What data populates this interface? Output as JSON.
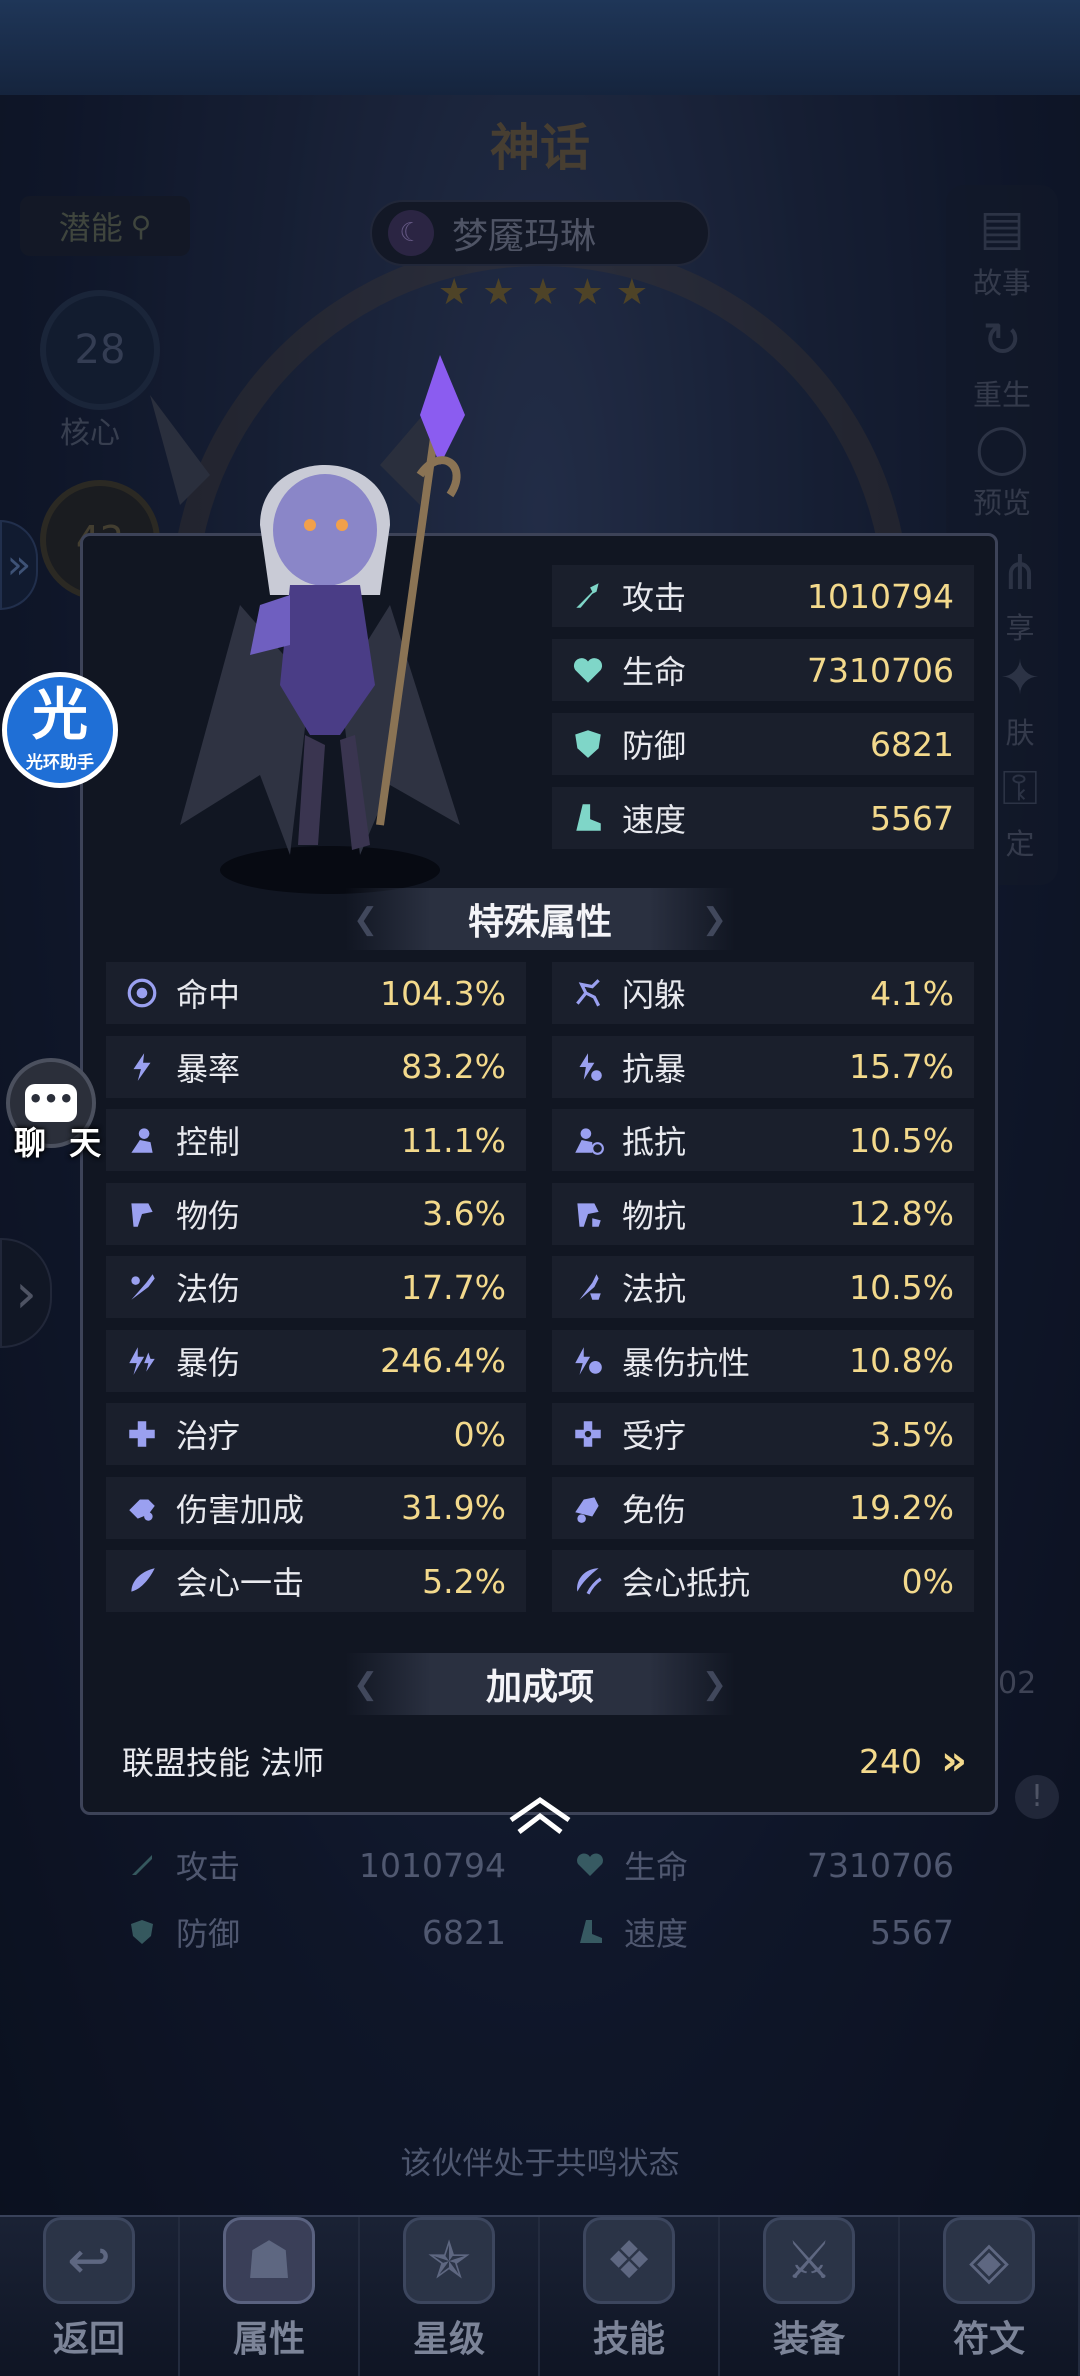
{
  "hero": {
    "tier_title": "神话",
    "name": "梦魇玛琳",
    "stars": 5
  },
  "left_panel": {
    "potential_label": "潜能",
    "core_level": "28",
    "core_label": "核心",
    "second_level": "42"
  },
  "right_rail": [
    {
      "label": "故事",
      "icon": "book-icon"
    },
    {
      "label": "重生",
      "icon": "rebirth-icon"
    },
    {
      "label": "预览",
      "icon": "preview-icon"
    },
    {
      "label": "享",
      "icon": "share-icon"
    },
    {
      "label": "肤",
      "icon": "skin-icon"
    },
    {
      "label": "定",
      "icon": "lock-icon"
    }
  ],
  "overlay": {
    "guanghuan_glyph": "光",
    "guanghuan_label": "光环助手",
    "chat_label": "聊 天"
  },
  "base_stats": [
    {
      "label": "攻击",
      "value": "1010794",
      "icon": "attack-icon"
    },
    {
      "label": "生命",
      "value": "7310706",
      "icon": "heart-icon"
    },
    {
      "label": "防御",
      "value": "6821",
      "icon": "shield-icon"
    },
    {
      "label": "速度",
      "value": "5567",
      "icon": "boot-icon"
    }
  ],
  "special_title": "特殊属性",
  "special_stats": [
    {
      "label": "命中",
      "value": "104.3%",
      "icon": "target-icon"
    },
    {
      "label": "闪躲",
      "value": "4.1%",
      "icon": "dodge-icon"
    },
    {
      "label": "暴率",
      "value": "83.2%",
      "icon": "crit-rate-icon"
    },
    {
      "label": "抗暴",
      "value": "15.7%",
      "icon": "crit-resist-icon"
    },
    {
      "label": "控制",
      "value": "11.1%",
      "icon": "control-icon"
    },
    {
      "label": "抵抗",
      "value": "10.5%",
      "icon": "resist-icon"
    },
    {
      "label": "物伤",
      "value": "3.6%",
      "icon": "phys-dmg-icon"
    },
    {
      "label": "物抗",
      "value": "12.8%",
      "icon": "phys-resist-icon"
    },
    {
      "label": "法伤",
      "value": "17.7%",
      "icon": "magic-dmg-icon"
    },
    {
      "label": "法抗",
      "value": "10.5%",
      "icon": "magic-resist-icon"
    },
    {
      "label": "暴伤",
      "value": "246.4%",
      "icon": "crit-dmg-icon"
    },
    {
      "label": "暴伤抗性",
      "value": "10.8%",
      "icon": "crit-dmg-resist-icon"
    },
    {
      "label": "治疗",
      "value": "0%",
      "icon": "heal-icon"
    },
    {
      "label": "受疗",
      "value": "3.5%",
      "icon": "heal-received-icon"
    },
    {
      "label": "伤害加成",
      "value": "31.9%",
      "icon": "dmg-bonus-icon"
    },
    {
      "label": "免伤",
      "value": "19.2%",
      "icon": "dmg-reduction-icon"
    },
    {
      "label": "会心一击",
      "value": "5.2%",
      "icon": "critical-strike-icon"
    },
    {
      "label": "会心抵抗",
      "value": "0%",
      "icon": "critical-resist-icon"
    }
  ],
  "bonus_title": "加成项",
  "bonus": {
    "label": "联盟技能 法师",
    "value": "240"
  },
  "ghost_stats": [
    {
      "label": "攻击",
      "value": "1010794"
    },
    {
      "label": "生命",
      "value": "7310706"
    },
    {
      "label": "防御",
      "value": "6821"
    },
    {
      "label": "速度",
      "value": "5567"
    }
  ],
  "right_number": "02",
  "resonance_text": "该伙伴处于共鸣状态",
  "bottom_nav": [
    {
      "label": "返回",
      "icon": "back-icon"
    },
    {
      "label": "属性",
      "icon": "attributes-icon"
    },
    {
      "label": "星级",
      "icon": "star-level-icon"
    },
    {
      "label": "技能",
      "icon": "skill-book-icon"
    },
    {
      "label": "装备",
      "icon": "equipment-icon"
    },
    {
      "label": "符文",
      "icon": "rune-icon"
    }
  ],
  "colors": {
    "value_gold": "#f3d98c",
    "panel_bg": "#111622",
    "row_bg": "#1a1f2c",
    "icon_teal": "#7fd6c8",
    "icon_purple": "#9aa0f0"
  }
}
